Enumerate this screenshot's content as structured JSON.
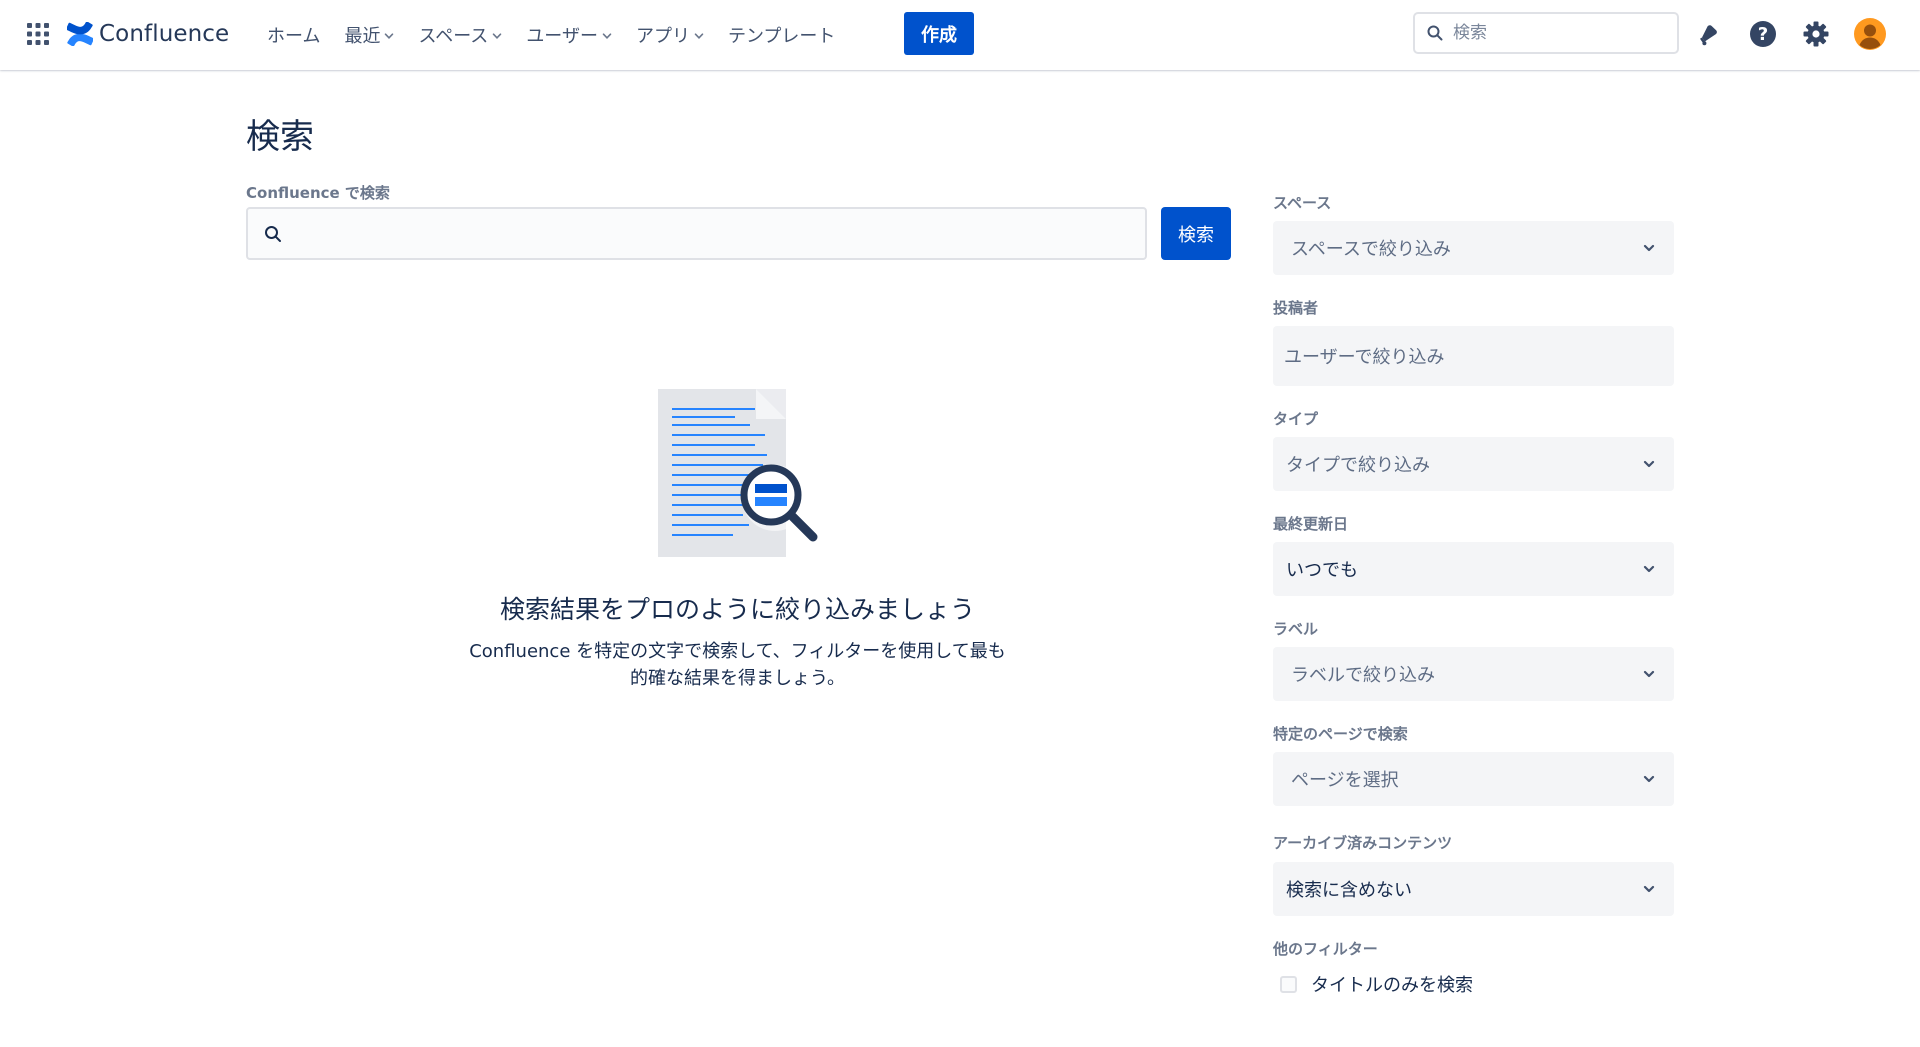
{
  "nav": {
    "brand": "Confluence",
    "items": [
      {
        "label": "ホーム",
        "dropdown": false
      },
      {
        "label": "最近",
        "dropdown": true
      },
      {
        "label": "スペース",
        "dropdown": true
      },
      {
        "label": "ユーザー",
        "dropdown": true
      },
      {
        "label": "アプリ",
        "dropdown": true
      },
      {
        "label": "テンプレート",
        "dropdown": false
      }
    ],
    "create_label": "作成",
    "search_placeholder": "検索",
    "icons": [
      "apps-grid-icon",
      "confluence-logo-icon",
      "notification-icon",
      "help-icon",
      "settings-icon",
      "avatar-icon"
    ],
    "accent_color": "#0052cc"
  },
  "main": {
    "title": "検索",
    "search_label": "Confluence で検索",
    "search_value": "",
    "search_button": "検索",
    "empty_heading": "検索結果をプロのように絞り込みましょう",
    "empty_body": "Confluence を特定の文字で検索して、フィルターを使用して最も的確な結果を得ましょう。"
  },
  "filters": {
    "space": {
      "label": "スペース",
      "value": "スペースで絞り込み"
    },
    "contributor": {
      "label": "投稿者",
      "placeholder": "ユーザーで絞り込み"
    },
    "type": {
      "label": "タイプ",
      "value": "タイプで絞り込み"
    },
    "last_modified": {
      "label": "最終更新日",
      "value": "いつでも"
    },
    "label": {
      "label": "ラベル",
      "value": "ラベルで絞り込み"
    },
    "page": {
      "label": "特定のページで検索",
      "value": "ページを選択"
    },
    "archived": {
      "label": "アーカイブ済みコンテンツ",
      "value": "検索に含めない"
    },
    "other": {
      "label": "他のフィルター",
      "title_only": "タイトルのみを検索",
      "title_only_checked": false
    }
  }
}
